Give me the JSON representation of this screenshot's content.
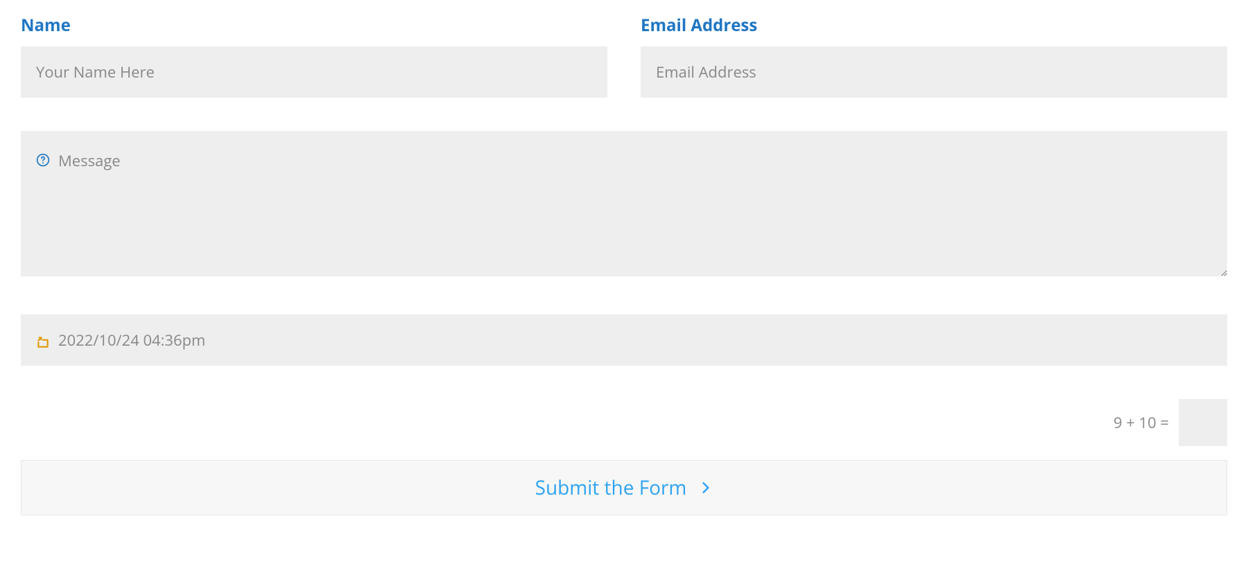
{
  "colors": {
    "label": "#1f76c4",
    "inputBg": "#eeeeee",
    "placeholder": "#888888",
    "submitText": "#2ea3f2",
    "submitBg": "#f7f7f7",
    "submitBorder": "#e6e6e6",
    "dtIcon": "#e09900"
  },
  "form": {
    "name": {
      "label": "Name",
      "placeholder": "Your Name Here",
      "value": ""
    },
    "email": {
      "label": "Email Address",
      "placeholder": "Email Address",
      "value": ""
    },
    "message": {
      "placeholder": "Message",
      "value": "",
      "icon": "question-circle-icon"
    },
    "datetime": {
      "value": "2022/10/24 04:36pm",
      "icon": "compose-arrow-icon"
    },
    "captcha": {
      "question": "9 + 10 =",
      "value": ""
    },
    "submit": {
      "label": "Submit the Form",
      "icon": "chevron-right-icon"
    }
  }
}
